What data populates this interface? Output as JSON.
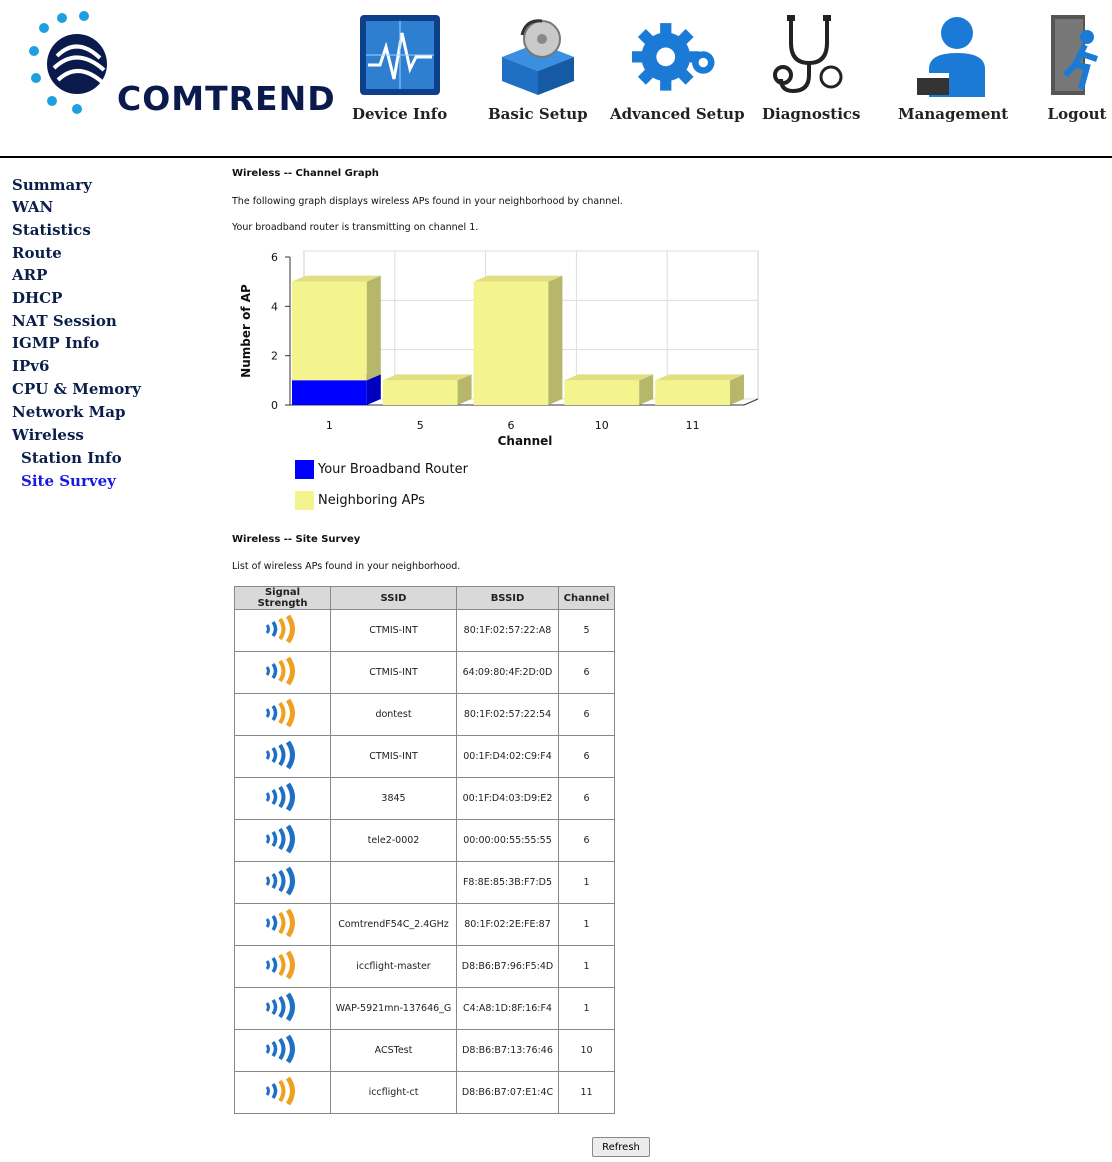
{
  "brand": {
    "logo_text": "COMTREND"
  },
  "nav": [
    {
      "id": "device-info",
      "label": "Device Info",
      "icon": "device-info-icon"
    },
    {
      "id": "basic-setup",
      "label": "Basic Setup",
      "icon": "basic-setup-icon"
    },
    {
      "id": "advanced-setup",
      "label": "Advanced Setup",
      "icon": "advanced-setup-icon"
    },
    {
      "id": "diagnostics",
      "label": "Diagnostics",
      "icon": "stethoscope-icon"
    },
    {
      "id": "management",
      "label": "Management",
      "icon": "management-icon"
    },
    {
      "id": "logout",
      "label": "Logout",
      "icon": "logout-icon"
    }
  ],
  "sidebar": {
    "items": [
      {
        "label": "Summary"
      },
      {
        "label": "WAN"
      },
      {
        "label": "Statistics"
      },
      {
        "label": "Route"
      },
      {
        "label": "ARP"
      },
      {
        "label": "DHCP"
      },
      {
        "label": "NAT Session"
      },
      {
        "label": "IGMP Info"
      },
      {
        "label": "IPv6"
      },
      {
        "label": "CPU & Memory"
      },
      {
        "label": "Network Map"
      },
      {
        "label": "Wireless"
      },
      {
        "label": "Station Info",
        "sub": true
      },
      {
        "label": "Site Survey",
        "sub": true,
        "active": true
      }
    ]
  },
  "channel_graph": {
    "title": "Wireless -- Channel Graph",
    "desc": "The following graph displays wireless APs found in your neighborhood by channel.",
    "current": "Your broadband router is transmitting on channel 1."
  },
  "chart_data": {
    "type": "bar",
    "categories": [
      "1",
      "5",
      "6",
      "10",
      "11"
    ],
    "series": [
      {
        "name": "Your Broadband Router",
        "values": [
          1,
          0,
          0,
          0,
          0
        ],
        "color": "#0000ff"
      },
      {
        "name": "Neighboring APs",
        "values": [
          4,
          1,
          5,
          1,
          1
        ],
        "color": "#f4f48e"
      }
    ],
    "stacked": true,
    "xlabel": "Channel",
    "ylabel": "Number of AP",
    "ylim": [
      0,
      6
    ],
    "yticks": [
      0,
      2,
      4,
      6
    ],
    "grid": true,
    "legend": "below"
  },
  "site_survey": {
    "title": "Wireless -- Site Survey",
    "desc": "List of wireless APs found in your neighborhood.",
    "headers": [
      "Signal Strength",
      "SSID",
      "BSSID",
      "Channel"
    ],
    "rows": [
      {
        "signal": "strong",
        "ssid": "CTMIS-INT",
        "bssid": "80:1F:02:57:22:A8",
        "channel": "5"
      },
      {
        "signal": "strong",
        "ssid": "CTMIS-INT",
        "bssid": "64:09:80:4F:2D:0D",
        "channel": "6"
      },
      {
        "signal": "strong",
        "ssid": "dontest",
        "bssid": "80:1F:02:57:22:54",
        "channel": "6"
      },
      {
        "signal": "medium",
        "ssid": "CTMIS-INT",
        "bssid": "00:1F:D4:02:C9:F4",
        "channel": "6"
      },
      {
        "signal": "medium",
        "ssid": "3845",
        "bssid": "00:1F:D4:03:D9:E2",
        "channel": "6"
      },
      {
        "signal": "medium",
        "ssid": "tele2-0002",
        "bssid": "00:00:00:55:55:55",
        "channel": "6"
      },
      {
        "signal": "medium",
        "ssid": "",
        "bssid": "F8:8E:85:3B:F7:D5",
        "channel": "1"
      },
      {
        "signal": "strong",
        "ssid": "ComtrendF54C_2.4GHz",
        "bssid": "80:1F:02:2E:FE:87",
        "channel": "1"
      },
      {
        "signal": "strong",
        "ssid": "iccflight-master",
        "bssid": "D8:B6:B7:96:F5:4D",
        "channel": "1"
      },
      {
        "signal": "medium",
        "ssid": "WAP-5921mn-137646_G",
        "bssid": "C4:A8:1D:8F:16:F4",
        "channel": "1"
      },
      {
        "signal": "medium",
        "ssid": "ACSTest",
        "bssid": "D8:B6:B7:13:76:46",
        "channel": "10"
      },
      {
        "signal": "strong",
        "ssid": "iccflight-ct",
        "bssid": "D8:B6:B7:07:E1:4C",
        "channel": "11"
      }
    ],
    "refresh_label": "Refresh"
  },
  "colors": {
    "router": "#0000ff",
    "neighbor": "#f4f48e",
    "signal_strong": "#f0a020",
    "signal_medium": "#1f6fc5"
  }
}
